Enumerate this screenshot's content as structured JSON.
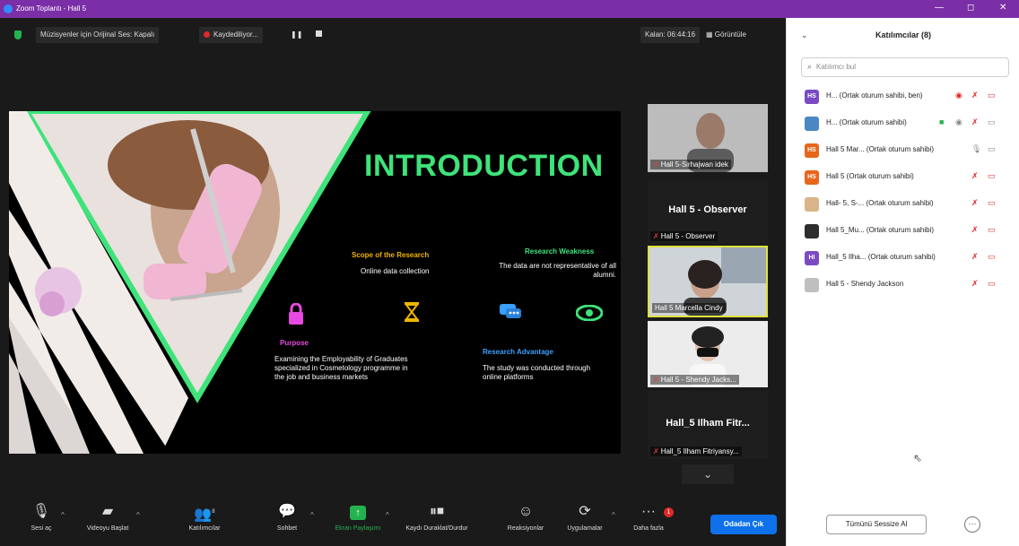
{
  "window": {
    "title": "Zoom Toplantı - Hall 5",
    "minimize": "—",
    "maximize": "◻",
    "close": "✕"
  },
  "topbar": {
    "music_mode": "Müzisyenler için Orijinal Ses: Kapalı",
    "recording": "Kaydediliyor...",
    "pause": "❚❚",
    "timer": "Kalan: 06:44:16",
    "view": "Görüntüle"
  },
  "slide": {
    "title": "INTRODUCTION",
    "scope_title": "Scope of the Research",
    "scope_body": "Online data collection",
    "weak_title": "Research Weakness",
    "weak_body": "The data are not representative of all alumni.",
    "purpose_title": "Purpose",
    "purpose_body": "Examining the Employability of Graduates specialized in Cosmetology programme in the job and business markets",
    "adv_title": "Research Advantage",
    "adv_body": "The study was conducted through online platforms",
    "colors": {
      "accent": "#3ee37a",
      "gold": "#f0b400",
      "pink": "#e64ae0",
      "blue": "#3aa0ff"
    }
  },
  "thumbnails": [
    {
      "caption": "Hall 5-Sirhajwan idek"
    },
    {
      "big": "Hall 5 - Observer",
      "caption": "Hall 5 - Observer"
    },
    {
      "caption": "Hall 5 Marcella Cindy"
    },
    {
      "caption": "Hall 5 - Shendy Jacks..."
    },
    {
      "big": "Hall_5 Ilham Fitr...",
      "caption": "Hall_5 Ilham Fitriyansy..."
    }
  ],
  "toolbar": {
    "audio": "Sesi aç",
    "video": "Videoyu Başlat",
    "participants": "Katılımcılar",
    "participants_count": "8",
    "chat": "Sohbet",
    "share": "Ekran Paylaşımı",
    "record": "Kaydı Duraklat/Durdur",
    "reactions": "Reaksiyonlar",
    "apps": "Uygulamalar",
    "more": "Daha fazla",
    "more_badge": "1",
    "leave": "Odadan Çık"
  },
  "panel": {
    "title": "Katılımcılar (8)",
    "search_placeholder": "Katılımcı bul",
    "participants": [
      {
        "initials": "HS",
        "name": "H... (Ortak oturum sahibi, ben)"
      },
      {
        "initials": "",
        "name": "H... (Ortak oturum sahibi)"
      },
      {
        "initials": "HS",
        "name": "Hall 5 Mar... (Ortak oturum sahibi)"
      },
      {
        "initials": "HS",
        "name": "Hall 5 (Ortak oturum sahibi)"
      },
      {
        "initials": "",
        "name": "Hall- 5, S-... (Ortak oturum sahibi)"
      },
      {
        "initials": "",
        "name": "Hall 5_Mu... (Ortak oturum sahibi)"
      },
      {
        "initials": "HI",
        "name": "Hall_5 Ilha... (Ortak oturum sahibi)"
      },
      {
        "initials": "",
        "name": "Hall 5 - Shendy Jackson"
      }
    ],
    "mute_all": "Tümünü Sessize Al",
    "more": "···"
  }
}
